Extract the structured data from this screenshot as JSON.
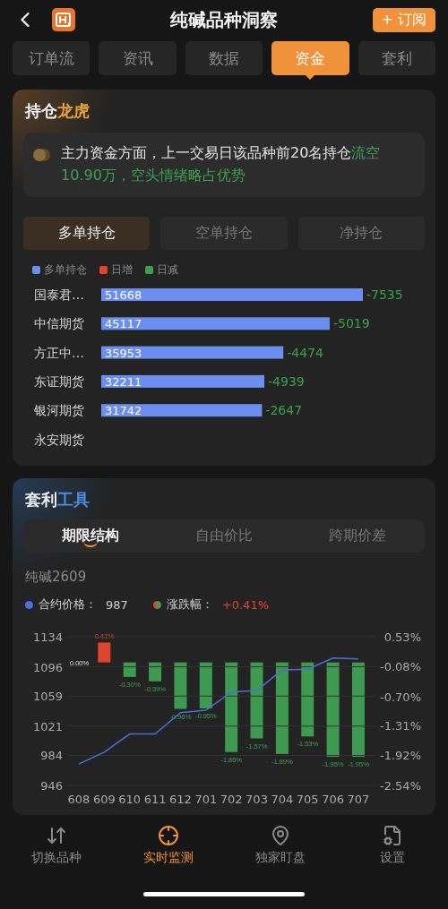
{
  "header": {
    "title": "纯碱品种洞察",
    "subscribe": "+ 订阅"
  },
  "tabs": [
    {
      "label": "订单流",
      "selected": false
    },
    {
      "label": "资讯",
      "selected": false
    },
    {
      "label": "数据",
      "selected": false
    },
    {
      "label": "资金",
      "selected": true
    },
    {
      "label": "套利",
      "selected": false
    }
  ],
  "positions": {
    "title": "持仓",
    "title_accent": "龙虎",
    "summary": "主力资金方面，上一交易日该品种前20名持仓",
    "summary_highlight": "流空10.90万，空头情绪略占优势",
    "subtabs": [
      {
        "label": "多单持仓",
        "selected": true
      },
      {
        "label": "空单持仓",
        "selected": false
      },
      {
        "label": "净持仓",
        "selected": false
      }
    ],
    "legend": [
      {
        "label": "日增",
        "color": "#e0442f"
      },
      {
        "label": "日减",
        "color": "#3aa04a"
      }
    ],
    "chart_data": {
      "type": "bar",
      "orientation": "horizontal",
      "categories": [
        "国泰君…",
        "中信期货",
        "方正中…",
        "东证期货",
        "银河期货",
        "永安期货"
      ],
      "series": [
        {
          "name": "多单持仓",
          "color": "#6b8ef0",
          "values": [
            51668,
            45117,
            35953,
            32211,
            31742,
            null
          ]
        }
      ],
      "data_labels": true,
      "annotations": [
        "-7535",
        "-5019",
        "-4474",
        "-4939",
        "-2647"
      ]
    }
  },
  "arbitrage": {
    "title": "套利",
    "title_accent": "工具",
    "subtabs": [
      {
        "label": "期限结构",
        "selected": true
      },
      {
        "label": "自由价比",
        "selected": false
      },
      {
        "label": "跨期价差",
        "selected": false
      }
    ],
    "contract": "纯碱2609",
    "separator": "：",
    "price": "987",
    "change": "+0.41%",
    "price_chart": {
      "chart_data": {
        "type": "line",
        "ylim": [
          946,
          1134
        ],
        "yticks": [
          1134,
          1096,
          1059,
          1021,
          984,
          946
        ],
        "grid": true,
        "series": [
          {
            "name": "合约价格",
            "color": "#4a6fd8",
            "values": [
              973,
              988,
              1011,
              1011,
              1038,
              1041,
              1064,
              1066,
              1092,
              1093,
              1107,
              1106
            ]
          }
        ]
      }
    },
    "change_chart": {
      "chart_data": {
        "type": "bar",
        "categories": [
          "608",
          "609",
          "610",
          "611",
          "612",
          "701",
          "702",
          "703",
          "704",
          "705",
          "706",
          "707"
        ],
        "ylim": [
          -2.54,
          0.53
        ],
        "yticks": [
          {
            "value": 0.53,
            "label": "0.53%"
          },
          {
            "value": -0.08,
            "label": "-0.08%"
          },
          {
            "value": -0.7,
            "label": "-0.70%"
          },
          {
            "value": -1.31,
            "label": "-1.31%"
          },
          {
            "value": -1.92,
            "label": "-1.92%"
          },
          {
            "value": -2.54,
            "label": "-2.54%"
          }
        ],
        "series": [
          {
            "name": "涨跌幅",
            "color": "#3d9a50",
            "colors": [
              "#3d9a50",
              "#e0442f",
              "#3d9a50",
              "#3d9a50",
              "#3d9a50",
              "#3d9a50",
              "#3d9a50",
              "#3d9a50",
              "#3d9a50",
              "#3d9a50",
              "#3d9a50",
              "#3d9a50"
            ],
            "values": [
              0,
              0.41,
              -0.3,
              -0.39,
              -0.96,
              -0.95,
              -1.85,
              -1.57,
              -1.89,
              -1.53,
              -1.95,
              -1.95
            ]
          }
        ],
        "value_labels": [
          "0.00%",
          "0.41%",
          "-0.30%",
          "-0.39%",
          "-0.96%",
          "-0.95%",
          "-1.85%",
          "-1.57%",
          "-1.89%",
          "-1.53%",
          "-1.95%",
          "-1.95%"
        ]
      }
    }
  },
  "nav": [
    {
      "label": "切换品种",
      "selected": false,
      "kind": "switch"
    },
    {
      "label": "实时监测",
      "selected": true,
      "kind": "monitor"
    },
    {
      "label": "独家盯盘",
      "selected": false,
      "kind": "watch"
    },
    {
      "label": "设置",
      "selected": false,
      "kind": "settings"
    }
  ]
}
